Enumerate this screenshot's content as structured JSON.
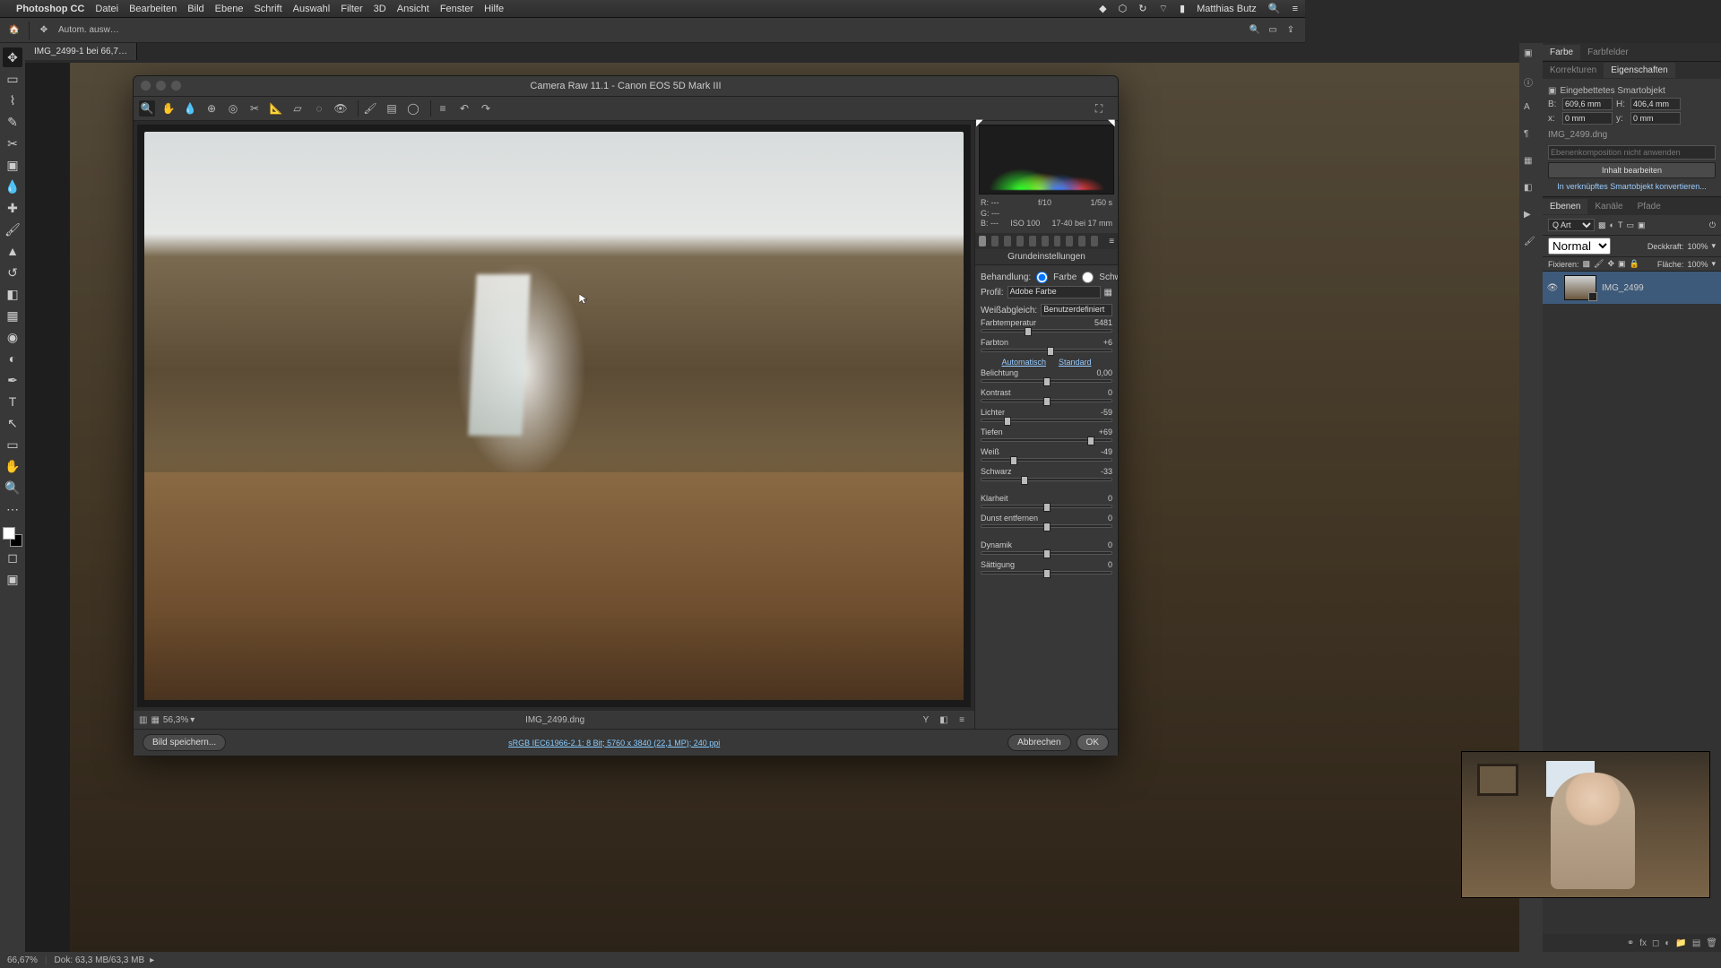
{
  "menubar": {
    "app": "Photoshop CC",
    "items": [
      "Datei",
      "Bearbeiten",
      "Bild",
      "Ebene",
      "Schrift",
      "Auswahl",
      "Filter",
      "3D",
      "Ansicht",
      "Fenster",
      "Hilfe"
    ],
    "user": "Matthias Butz"
  },
  "options_bar": {
    "auto_label": "Autom. ausw…"
  },
  "doc_tab": "IMG_2499-1 bei 66,7…",
  "status": {
    "zoom": "66,67%",
    "docsize": "Dok: 63,3 MB/63,3 MB"
  },
  "camera_raw": {
    "title": "Camera Raw 11.1 - Canon EOS 5D Mark III",
    "zoom": "56,3%",
    "filename": "IMG_2499.dng",
    "meta": {
      "r": "R:  ---",
      "g": "G:  ---",
      "b": "B:  ---",
      "aperture": "f/10",
      "shutter": "1/50 s",
      "iso": "ISO 100",
      "focal": "17-40 bei 17 mm"
    },
    "panel_title": "Grundeinstellungen",
    "behandlung_label": "Behandlung:",
    "color_label": "Farbe",
    "bw_label": "Schwarzweiß",
    "profile_label": "Profil:",
    "profile_value": "Adobe Farbe",
    "wb_label": "Weißabgleich:",
    "wb_value": "Benutzerdefiniert",
    "auto_label": "Automatisch",
    "standard_label": "Standard",
    "sliders": {
      "farbtemperatur": {
        "label": "Farbtemperatur",
        "value": "5481",
        "pos": 36
      },
      "farbton": {
        "label": "Farbton",
        "value": "+6",
        "pos": 53
      },
      "belichtung": {
        "label": "Belichtung",
        "value": "0,00",
        "pos": 50
      },
      "kontrast": {
        "label": "Kontrast",
        "value": "0",
        "pos": 50
      },
      "lichter": {
        "label": "Lichter",
        "value": "-59",
        "pos": 20
      },
      "tiefen": {
        "label": "Tiefen",
        "value": "+69",
        "pos": 84
      },
      "weiss": {
        "label": "Weiß",
        "value": "-49",
        "pos": 25
      },
      "schwarz": {
        "label": "Schwarz",
        "value": "-33",
        "pos": 33
      },
      "klarheit": {
        "label": "Klarheit",
        "value": "0",
        "pos": 50
      },
      "dunst": {
        "label": "Dunst entfernen",
        "value": "0",
        "pos": 50
      },
      "dynamik": {
        "label": "Dynamik",
        "value": "0",
        "pos": 50
      },
      "saettigung": {
        "label": "Sättigung",
        "value": "0",
        "pos": 50
      }
    },
    "save_button": "Bild speichern...",
    "workflow_link": "sRGB IEC61966-2.1: 8 Bit; 5760 x 3840 (22,1 MP); 240 ppi",
    "cancel": "Abbrechen",
    "ok": "OK"
  },
  "panels": {
    "farbe_tab": "Farbe",
    "farbfelder_tab": "Farbfelder",
    "korrekturen_tab": "Korrekturen",
    "eigenschaften_tab": "Eigenschaften",
    "smartobj": "Eingebettetes Smartobjekt",
    "width_label": "B:",
    "width_val": "609,6 mm",
    "height_label": "H:",
    "height_val": "406,4 mm",
    "x_label": "x:",
    "x_val": "0 mm",
    "y_label": "y:",
    "y_val": "0 mm",
    "so_filename": "IMG_2499.dng",
    "layercomp_placeholder": "Ebenenkomposition nicht anwenden",
    "edit_contents": "Inhalt bearbeiten",
    "convert_link": "In verknüpftes Smartobjekt konvertieren...",
    "ebenen_tab": "Ebenen",
    "kanaele_tab": "Kanäle",
    "pfade_tab": "Pfade",
    "kind_label": "Q Art",
    "blend_mode": "Normal",
    "opacity_label": "Deckkraft:",
    "opacity_val": "100%",
    "lock_label": "Fixieren:",
    "fill_label": "Fläche:",
    "fill_val": "100%",
    "layer_name": "IMG_2499"
  }
}
